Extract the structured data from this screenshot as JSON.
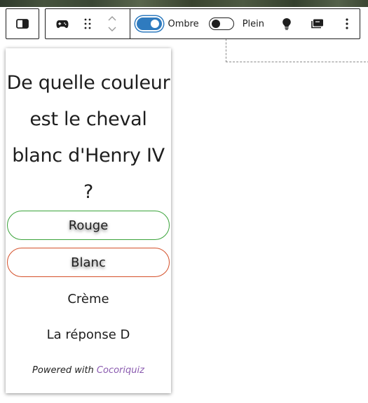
{
  "toolbar": {
    "ombre_label": "Ombre",
    "ombre_on": true,
    "plein_label": "Plein",
    "plein_on": false,
    "icons": [
      "sidebar-toggle-icon",
      "gamepad-icon",
      "drag-handle-icon",
      "chevron-up-icon",
      "chevron-down-icon",
      "lightbulb-icon",
      "card-icon",
      "more-vertical-icon"
    ]
  },
  "quiz": {
    "question": "De quelle couleur est le cheval blanc d'Henry IV ?",
    "answers": [
      {
        "label": "Rouge",
        "border_color": "#3aa33a"
      },
      {
        "label": "Blanc",
        "border_color": "#d4502a"
      },
      {
        "label": "Crème"
      },
      {
        "label": "La réponse D"
      }
    ],
    "powered_prefix": "Powered with",
    "powered_link": "Cocoriquiz",
    "link_color": "#8b5cb0"
  },
  "colors": {
    "toggle_on": "#2f7bbf",
    "text": "#1e1e1e"
  }
}
